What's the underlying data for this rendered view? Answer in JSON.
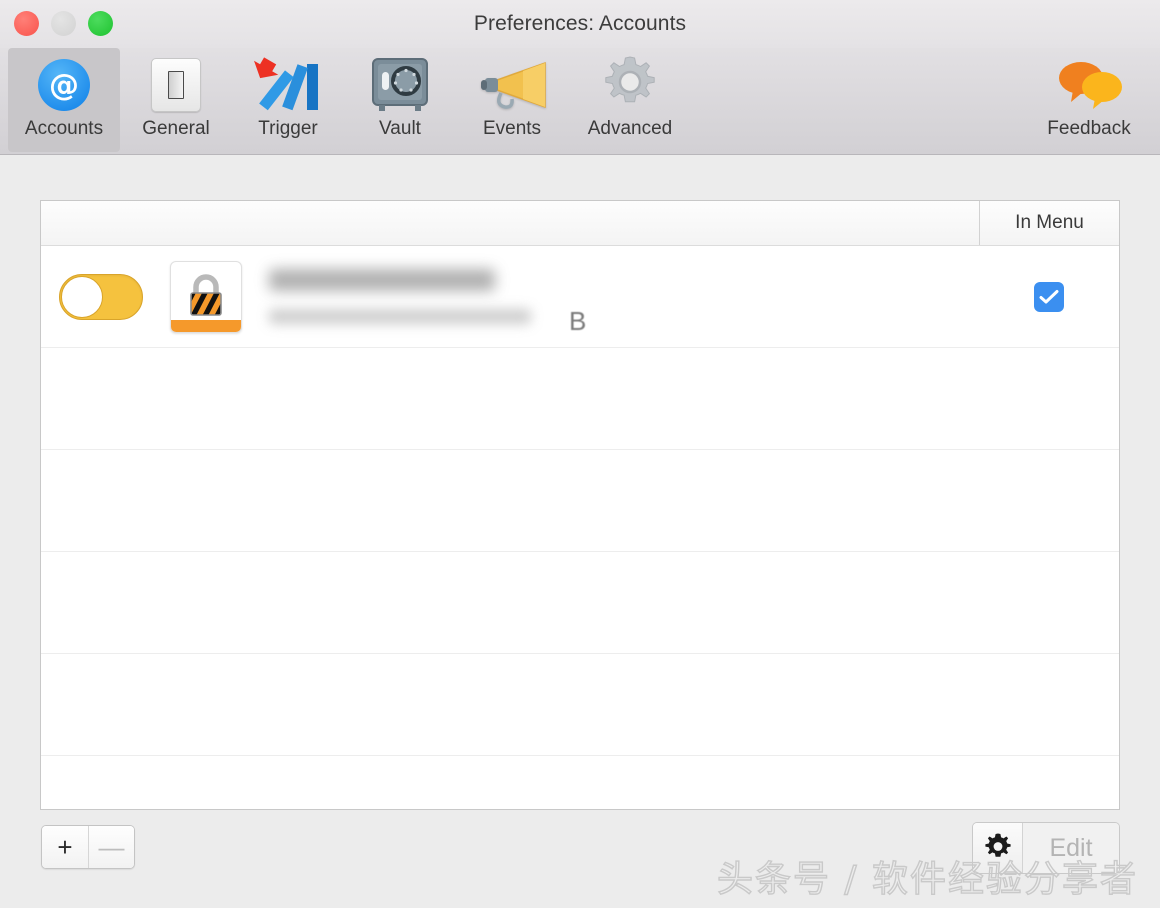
{
  "window": {
    "title": "Preferences: Accounts",
    "traffic_lights": [
      {
        "name": "close",
        "color": "#f9534b"
      },
      {
        "name": "minimize",
        "color": "#d2d2d2"
      },
      {
        "name": "zoom",
        "color": "#1ec22f"
      }
    ]
  },
  "toolbar": {
    "items": [
      {
        "label": "Accounts",
        "icon": "at-sign-icon",
        "selected": true
      },
      {
        "label": "General",
        "icon": "light-switch-icon",
        "selected": false
      },
      {
        "label": "Trigger",
        "icon": "falling-dominoes-icon",
        "selected": false
      },
      {
        "label": "Vault",
        "icon": "safe-icon",
        "selected": false
      },
      {
        "label": "Events",
        "icon": "megaphone-icon",
        "selected": false
      },
      {
        "label": "Advanced",
        "icon": "gear-icon",
        "selected": false
      }
    ],
    "feedback": {
      "label": "Feedback",
      "icon": "speech-bubbles-icon"
    }
  },
  "table": {
    "header": {
      "account_column": "",
      "in_menu_column": "In Menu"
    },
    "rows": [
      {
        "enabled": false,
        "app_icon": "padlock-icon",
        "title": "",
        "subtitle": "",
        "subtitle_tail": "B",
        "in_menu": true
      },
      {
        "empty": true
      },
      {
        "empty": true
      },
      {
        "empty": true
      },
      {
        "empty": true
      },
      {
        "empty": true
      }
    ]
  },
  "footer": {
    "add_label": "+",
    "remove_label": "—",
    "gear_icon": "gear-icon",
    "edit_label": "Edit"
  },
  "watermark": "头条号 / 软件经验分享者",
  "colors": {
    "accent_blue": "#3b8ff0",
    "toggle_yellow": "#f5c23e",
    "lock_orange": "#f5992b",
    "window_bg": "#ececec",
    "toolbar_bg": "#d8d6da"
  }
}
